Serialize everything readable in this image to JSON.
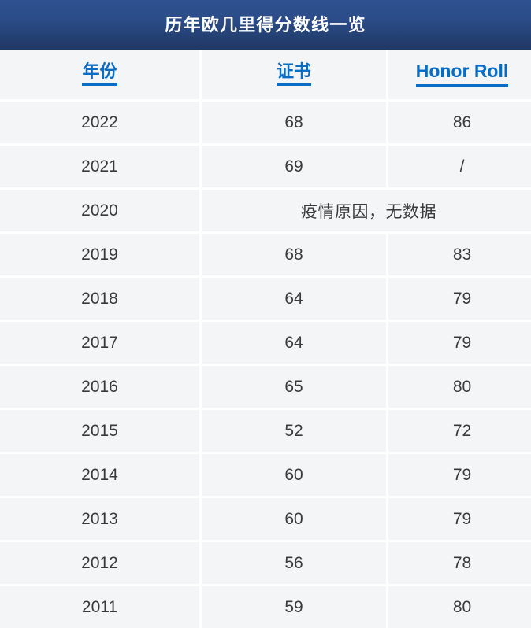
{
  "title": {
    "text": "历年欧几里得分数线一览"
  },
  "colors": {
    "title_bar_top": "#2e5290",
    "title_bar_bottom": "#1f3864",
    "title_text": "#ffffff",
    "header_link": "#0b6cc4",
    "cell_background": "#f4f5f7",
    "cell_gap": "#ffffff",
    "body_text": "#3a3a3a"
  },
  "table": {
    "headers": [
      {
        "label": "年份",
        "name": "year"
      },
      {
        "label": "证书",
        "name": "certificate"
      },
      {
        "label": "Honor Roll",
        "name": "honor-roll"
      }
    ],
    "rows": [
      {
        "year": "2022",
        "certificate": "68",
        "honor_roll": "86",
        "merged": false
      },
      {
        "year": "2021",
        "certificate": "69",
        "honor_roll": "/",
        "merged": false
      },
      {
        "year": "2020",
        "note": "疫情原因，无数据",
        "merged": true
      },
      {
        "year": "2019",
        "certificate": "68",
        "honor_roll": "83",
        "merged": false
      },
      {
        "year": "2018",
        "certificate": "64",
        "honor_roll": "79",
        "merged": false
      },
      {
        "year": "2017",
        "certificate": "64",
        "honor_roll": "79",
        "merged": false
      },
      {
        "year": "2016",
        "certificate": "65",
        "honor_roll": "80",
        "merged": false
      },
      {
        "year": "2015",
        "certificate": "52",
        "honor_roll": "72",
        "merged": false
      },
      {
        "year": "2014",
        "certificate": "60",
        "honor_roll": "79",
        "merged": false
      },
      {
        "year": "2013",
        "certificate": "60",
        "honor_roll": "79",
        "merged": false
      },
      {
        "year": "2012",
        "certificate": "56",
        "honor_roll": "78",
        "merged": false
      },
      {
        "year": "2011",
        "certificate": "59",
        "honor_roll": "80",
        "merged": false
      }
    ]
  }
}
